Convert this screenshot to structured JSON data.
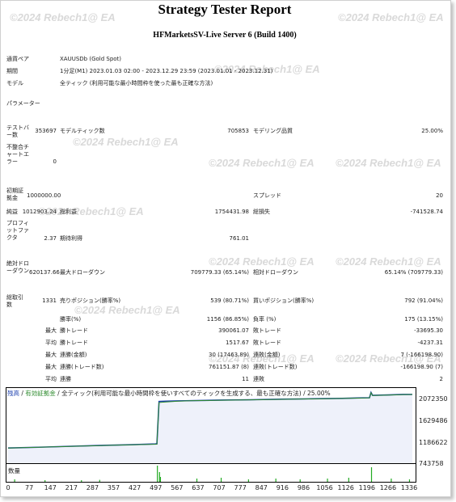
{
  "report": {
    "title": "Strategy Tester Report",
    "server": "HFMarketsSV-Live Server 6 (Build 1400)",
    "watermark": "©2024 Rebech1@ EA"
  },
  "settings": [
    {
      "label": "通貨ペア",
      "value": "XAUUSDb (Gold Spot)"
    },
    {
      "label": "期間",
      "value": "1分足(M1) 2023.01.03 02:00 - 2023.12.29 23:59 (2023.01.01 - 2023.12.31)"
    },
    {
      "label": "モデル",
      "value": "全ティック (利用可能な最小時間枠を使った最も正確な方法)"
    },
    {
      "label": "パラメーター",
      "value": ""
    }
  ],
  "rows": {
    "bars_label": "テストバー数",
    "bars_value": "353697",
    "ticks_label": "モデルティック数",
    "ticks_value": "705853",
    "quality_label": "モデリング品質",
    "quality_value": "25.00%",
    "mismatch_label": "不整合チャートエラー",
    "mismatch_value": "0",
    "deposit_label": "初期証拠金",
    "deposit_value": "1000000.00",
    "spread_label": "スプレッド",
    "spread_value": "20",
    "netprofit_label": "純益",
    "netprofit_value": "1012903.24",
    "grossprofit_label": "総利益",
    "grossprofit_value": "1754431.98",
    "grossloss_label": "総損失",
    "grossloss_value": "-741528.74",
    "pf_label": "プロフィットファクタ",
    "pf_value": "2.37",
    "expected_label": "期待利得",
    "expected_value": "761.01",
    "absdd_label": "絶対ドローダウン",
    "absdd_value": "620137.66",
    "maxdd_label": "最大ドローダウン",
    "maxdd_value": "709779.33 (65.14%)",
    "reldd_label": "相対ドローダウン",
    "reldd_value": "65.14% (709779.33)",
    "trades_label": "総取引数",
    "trades_value": "1331",
    "short_label": "売りポジション(勝率%)",
    "short_value": "539 (80.71%)",
    "long_label": "買いポジション(勝率%)",
    "long_value": "792 (91.04%)",
    "win_label": "勝率(%)",
    "win_value": "1156 (86.85%)",
    "loss_label": "負率 (%)",
    "loss_value": "175 (13.15%)",
    "largest_label": "最大",
    "largest_win_label": "勝トレード",
    "largest_win_value": "390061.07",
    "largest_loss_label": "敗トレード",
    "largest_loss_value": "-33695.30",
    "avg_label": "平均",
    "avg_win_label": "勝トレード",
    "avg_win_value": "1517.67",
    "avg_loss_label": "敗トレード",
    "avg_loss_value": "-4237.31",
    "maxcons_label": "最大",
    "maxcons_win_label": "連勝(金額)",
    "maxcons_win_value": "30 (17463.89)",
    "maxcons_loss_label": "連敗(金額)",
    "maxcons_loss_value": "7 (-166198.90)",
    "maxconsp_label": "最大",
    "maxconsp_win_label": "連勝(トレード数)",
    "maxconsp_win_value": "761151.87 (8)",
    "maxconsp_loss_label": "連敗(トレード数)",
    "maxconsp_loss_value": "-166198.90 (7)",
    "avgcons_label": "平均",
    "avgcons_win_label": "連勝",
    "avgcons_win_value": "11",
    "avgcons_loss_label": "連敗",
    "avgcons_loss_value": "2"
  },
  "chart_header": {
    "balance": "残高",
    "sep1": " / ",
    "equity": "有効証拠金",
    "rest": " / 全ティック(利用可能な最小時間枠を使いすべてのティックを生成する、最も正確な方法) / 25.00%",
    "volume": "数量"
  },
  "chart_data": {
    "type": "line",
    "title": "",
    "xlabel": "",
    "ylabel": "",
    "x_ticks": [
      "0",
      "77",
      "147",
      "217",
      "287",
      "357",
      "427",
      "497",
      "567",
      "637",
      "707",
      "777",
      "847",
      "916",
      "986",
      "1056",
      "1126",
      "1196",
      "1266",
      "1336"
    ],
    "y_ticks": [
      "2072350",
      "1629486",
      "1186622",
      "743758"
    ],
    "xlim": [
      0,
      1331
    ],
    "ylim": [
      743758,
      2072350
    ],
    "colors": {
      "balance": "#1b3fae",
      "equity": "#2e8b2e",
      "volume": "#22aa22"
    },
    "series": [
      {
        "name": "残高",
        "x": [
          0,
          100,
          200,
          300,
          400,
          485,
          490,
          497,
          520,
          560,
          600,
          700,
          800,
          900,
          1000,
          1100,
          1150,
          1190,
          1195,
          1200,
          1250,
          1300,
          1331
        ],
        "y": [
          1000000,
          1015000,
          1032000,
          1048000,
          1062000,
          1078000,
          1080000,
          1880000,
          1885000,
          1890000,
          1895000,
          1905000,
          1912000,
          1922000,
          1930000,
          1938000,
          1945000,
          1950000,
          2050000,
          1995000,
          2002000,
          2012000,
          2013000
        ]
      },
      {
        "name": "有効証拠金",
        "x": [
          0,
          100,
          200,
          300,
          400,
          480,
          490,
          497,
          520,
          560,
          600,
          700,
          800,
          900,
          1000,
          1100,
          1150,
          1190,
          1195,
          1200,
          1250,
          1300,
          1331
        ],
        "y": [
          1000000,
          1014000,
          1030000,
          1045000,
          1060000,
          1070000,
          1072000,
          1860000,
          1870000,
          1885000,
          1893000,
          1902000,
          1910000,
          1920000,
          1928000,
          1936000,
          1942000,
          1948000,
          2045000,
          1992000,
          2000000,
          2010000,
          2012000
        ]
      }
    ],
    "volume": {
      "x": [
        20,
        120,
        240,
        300,
        490,
        497,
        500,
        620,
        700,
        790,
        880,
        960,
        1050,
        1120,
        1195,
        1260,
        1320
      ],
      "y": [
        0.15,
        0.1,
        0.1,
        0.12,
        1.0,
        0.6,
        0.3,
        0.2,
        0.25,
        0.15,
        0.2,
        0.15,
        0.2,
        0.25,
        0.9,
        0.2,
        0.15
      ]
    }
  }
}
